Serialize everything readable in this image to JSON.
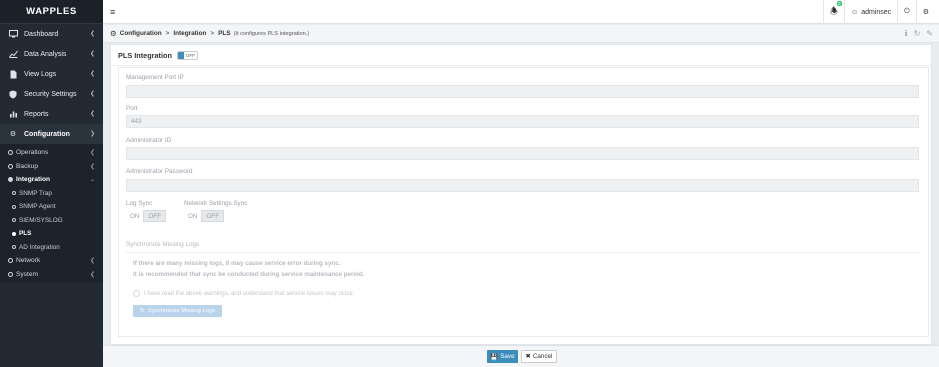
{
  "brand": {
    "logo": "WAPPLES"
  },
  "sidebar": {
    "items": [
      {
        "label": "Dashboard",
        "icon": "monitor-icon"
      },
      {
        "label": "Data Analysis",
        "icon": "chart-line-icon"
      },
      {
        "label": "View Logs",
        "icon": "file-icon"
      },
      {
        "label": "Security Settings",
        "icon": "shield-icon"
      },
      {
        "label": "Reports",
        "icon": "bar-chart-icon"
      },
      {
        "label": "Configuration",
        "icon": "gear-icon"
      }
    ],
    "config_sub": [
      {
        "label": "Operations"
      },
      {
        "label": "Backup"
      },
      {
        "label": "Integration"
      },
      {
        "label": "Network"
      },
      {
        "label": "System"
      }
    ],
    "integration_sub": [
      {
        "label": "SNMP Trap"
      },
      {
        "label": "SNMP Agent"
      },
      {
        "label": "SIEM/SYSLOG"
      },
      {
        "label": "PLS"
      },
      {
        "label": "AD Integration"
      }
    ]
  },
  "topbar": {
    "notification_count": "0",
    "user": "adminsec"
  },
  "breadcrumb": {
    "c1": "Configuration",
    "c2": "Integration",
    "c3": "PLS",
    "sep": ">",
    "description": "(It configures PLS integration.)"
  },
  "panel": {
    "title": "PLS Integration",
    "toggle_label": "OFF",
    "mgmt_ip_label": "Management Port IP",
    "mgmt_ip_value": "",
    "port_label": "Port",
    "port_value": "443",
    "admin_id_label": "Administrator ID",
    "admin_id_value": "",
    "admin_pw_label": "Administrator Password",
    "admin_pw_value": "",
    "log_sync_label": "Log Sync",
    "net_sync_label": "Network Settings Sync",
    "on_label": "ON",
    "off_label": "OFF",
    "missing_logs_title": "Synchronize Missing Logs",
    "warning_1": "If there are many missing logs, it may cause service error during sync.",
    "warning_2": "It is recommended that sync be conducted during service maintenance period.",
    "ack_label": "I have read the above warnings, and understand that service issues may occur.",
    "sync_button": "Synchronize Missing Logs"
  },
  "footer": {
    "save": "Save",
    "cancel": "Cancel"
  },
  "colors": {
    "primary": "#3c8dbc",
    "sidebar": "#232a33",
    "badge": "#2ecc71"
  }
}
